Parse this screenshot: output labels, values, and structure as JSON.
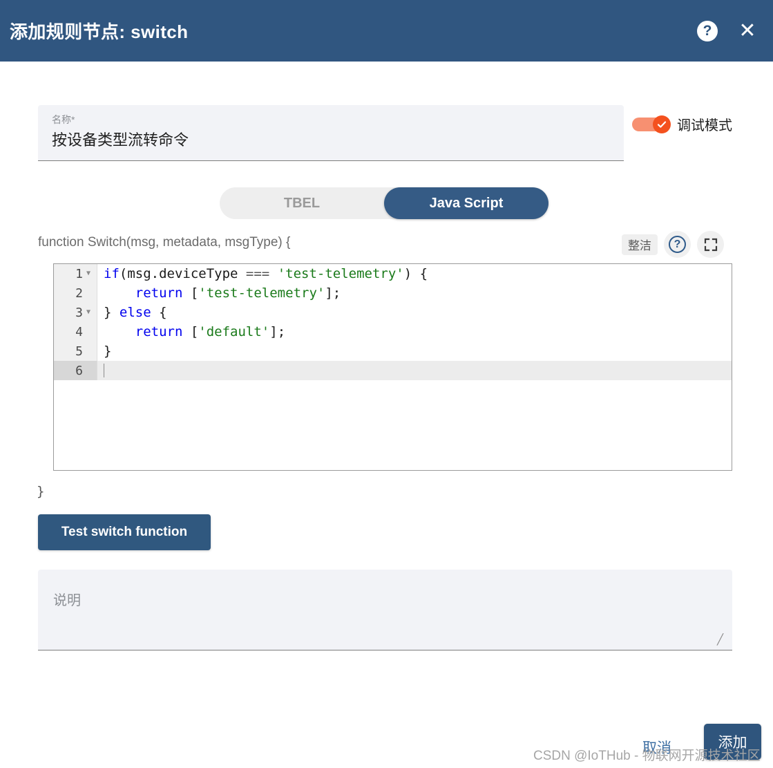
{
  "header": {
    "title": "添加规则节点: switch",
    "help_icon": "question-mark-circle-icon",
    "close_icon": "close-x-icon",
    "background_color": "#305680"
  },
  "name_field": {
    "label": "名称*",
    "value": "按设备类型流转命令",
    "placeholder": "名称*"
  },
  "debug_toggle": {
    "label": "调试模式",
    "checked": true,
    "accent_color": "#f4511e",
    "check_icon": "check-icon"
  },
  "language_toggle": {
    "options": [
      "TBEL",
      "Java Script"
    ],
    "selected": "Java Script",
    "inactive_label": "TBEL",
    "active_label": "Java Script",
    "active_color": "#355b85"
  },
  "function_signature": "function Switch(msg, metadata, msgType) {",
  "editor_tools": {
    "tidy_label": "整洁",
    "help_icon": "help-circle-icon",
    "fullscreen_icon": "fullscreen-expand-icon"
  },
  "code_editor": {
    "language": "javascript",
    "lines": [
      {
        "number": "1",
        "foldable": true,
        "active": false,
        "tokens": [
          {
            "t": "if",
            "c": "kw"
          },
          {
            "t": "(msg.deviceType ",
            "c": "def"
          },
          {
            "t": "===",
            "c": "op"
          },
          {
            "t": " ",
            "c": "def"
          },
          {
            "t": "'test-telemetry'",
            "c": "str"
          },
          {
            "t": ") {",
            "c": "def"
          }
        ],
        "plain": "if(msg.deviceType === 'test-telemetry') {"
      },
      {
        "number": "2",
        "foldable": false,
        "active": false,
        "tokens": [
          {
            "t": "    ",
            "c": "def"
          },
          {
            "t": "return",
            "c": "kw"
          },
          {
            "t": " [",
            "c": "def"
          },
          {
            "t": "'test-telemetry'",
            "c": "str"
          },
          {
            "t": "];",
            "c": "def"
          }
        ],
        "plain": "    return ['test-telemetry'];"
      },
      {
        "number": "3",
        "foldable": true,
        "active": false,
        "tokens": [
          {
            "t": "} ",
            "c": "def"
          },
          {
            "t": "else",
            "c": "kw"
          },
          {
            "t": " {",
            "c": "def"
          }
        ],
        "plain": "} else {"
      },
      {
        "number": "4",
        "foldable": false,
        "active": false,
        "tokens": [
          {
            "t": "    ",
            "c": "def"
          },
          {
            "t": "return",
            "c": "kw"
          },
          {
            "t": " [",
            "c": "def"
          },
          {
            "t": "'default'",
            "c": "str"
          },
          {
            "t": "];",
            "c": "def"
          }
        ],
        "plain": "    return ['default'];"
      },
      {
        "number": "5",
        "foldable": false,
        "active": false,
        "tokens": [
          {
            "t": "}",
            "c": "def"
          }
        ],
        "plain": "}"
      },
      {
        "number": "6",
        "foldable": false,
        "active": true,
        "tokens": [],
        "plain": ""
      }
    ]
  },
  "closing_brace": "}",
  "test_button": {
    "label": "Test switch function",
    "color": "#30587f"
  },
  "description_field": {
    "placeholder": "说明",
    "value": ""
  },
  "footer": {
    "cancel_label": "取消",
    "add_label": "添加",
    "add_color": "#2f557d"
  },
  "watermark": "CSDN @IoTHub - 物联网开源技术社区"
}
